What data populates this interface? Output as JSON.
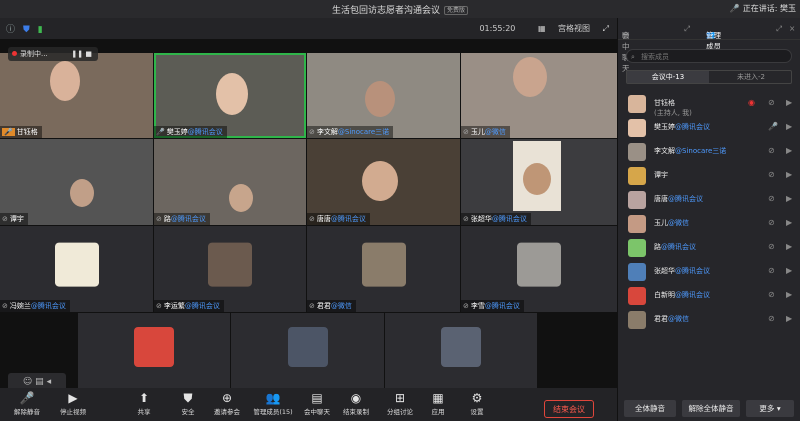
{
  "window": {
    "title": "生活包回访志愿者沟通会议",
    "badge": "免费版",
    "speaking": "正在讲话: 樊玉"
  },
  "stage": {
    "timer": "01:55:20",
    "view_mode": "宫格视图"
  },
  "recording": {
    "label": "录制中..."
  },
  "tiles": [
    {
      "name": "甘钰格",
      "org": ""
    },
    {
      "name": "樊玉婷",
      "org": "@腾讯会议"
    },
    {
      "name": "李文解",
      "org": "@Sinocare三诺"
    },
    {
      "name": "玉儿",
      "org": "@微信"
    },
    {
      "name": "谭宇",
      "org": ""
    },
    {
      "name": "路",
      "org": "@腾讯会议"
    },
    {
      "name": "唐唐",
      "org": "@腾讯会议"
    },
    {
      "name": "张超华",
      "org": "@腾讯会议"
    },
    {
      "name": "冯婉兰",
      "org": "@腾讯会议"
    },
    {
      "name": "李运繁",
      "org": "@腾讯会议"
    },
    {
      "name": "君君",
      "org": "@微信"
    },
    {
      "name": "李雪",
      "org": "@腾讯会议"
    }
  ],
  "toolbar": [
    {
      "label": "解除静音",
      "icon": "mic-muted-icon"
    },
    {
      "label": "停止视频",
      "icon": "video-icon"
    },
    {
      "label": "共享",
      "icon": "share-screen-icon"
    },
    {
      "label": "安全",
      "icon": "shield-icon"
    },
    {
      "label": "邀请参会",
      "icon": "invite-icon"
    },
    {
      "label": "管理成员(15)",
      "icon": "members-icon"
    },
    {
      "label": "会中聊天",
      "icon": "chat-icon"
    },
    {
      "label": "结束录制",
      "icon": "record-icon"
    },
    {
      "label": "分组讨论",
      "icon": "breakout-icon"
    },
    {
      "label": "应用",
      "icon": "apps-icon"
    },
    {
      "label": "设置",
      "icon": "settings-icon"
    }
  ],
  "end_meeting": "结束会议",
  "panel": {
    "tab_chat": "会中聊天",
    "tab_members": "管理成员(15)",
    "search_placeholder": "搜索成员",
    "seg_in": "会议中-13",
    "seg_out": "未进入-2",
    "members": [
      {
        "name": "甘钰格",
        "org": "",
        "sub": "(主持人, 我)"
      },
      {
        "name": "樊玉婷",
        "org": "@腾讯会议",
        "sub": ""
      },
      {
        "name": "李文解",
        "org": "@Sinocare三诺",
        "sub": ""
      },
      {
        "name": "谭宇",
        "org": "",
        "sub": ""
      },
      {
        "name": "唐唐",
        "org": "@腾讯会议",
        "sub": ""
      },
      {
        "name": "玉儿",
        "org": "@微信",
        "sub": ""
      },
      {
        "name": "路",
        "org": "@腾讯会议",
        "sub": ""
      },
      {
        "name": "张超华",
        "org": "@腾讯会议",
        "sub": ""
      },
      {
        "name": "白新明",
        "org": "@腾讯会议",
        "sub": ""
      },
      {
        "name": "君君",
        "org": "@微信",
        "sub": ""
      }
    ],
    "btn_mute_all": "全体静音",
    "btn_unmute_all": "解除全体静音",
    "btn_more": "更多"
  },
  "colors": {
    "accent_blue": "#4e9bff",
    "end_red": "#e0463b",
    "active_green": "#2fb54a"
  }
}
